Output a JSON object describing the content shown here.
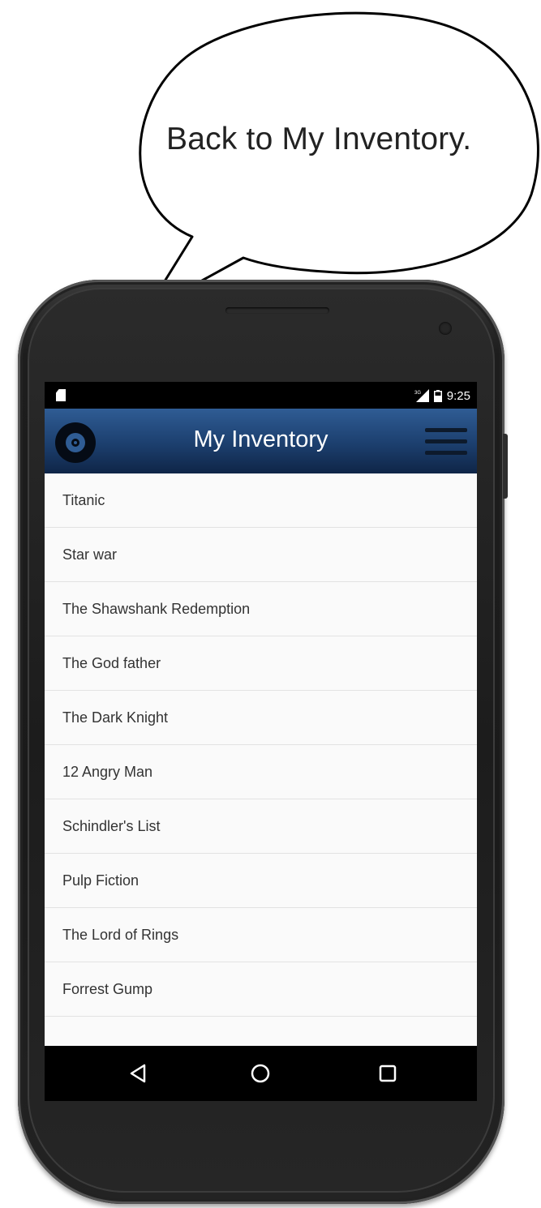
{
  "annotation": {
    "bubble_text": "Back to My Inventory."
  },
  "status_bar": {
    "time": "9:25",
    "icons": [
      "sd-card-icon",
      "signal-icon",
      "battery-icon"
    ]
  },
  "app_bar": {
    "title": "My Inventory",
    "logo_icon": "disc-icon",
    "menu_icon": "hamburger-menu-icon",
    "colors": {
      "top": "#2f5c94",
      "bottom": "#0f2547"
    }
  },
  "inventory": {
    "items": [
      {
        "title": "Titanic"
      },
      {
        "title": "Star war"
      },
      {
        "title": "The Shawshank Redemption"
      },
      {
        "title": "The God father"
      },
      {
        "title": "The Dark Knight"
      },
      {
        "title": "12 Angry Man"
      },
      {
        "title": "Schindler's List"
      },
      {
        "title": "Pulp Fiction"
      },
      {
        "title": "The Lord of Rings"
      },
      {
        "title": "Forrest Gump"
      }
    ]
  },
  "nav_bar": {
    "buttons": [
      "back-icon",
      "home-icon",
      "recents-icon"
    ]
  }
}
